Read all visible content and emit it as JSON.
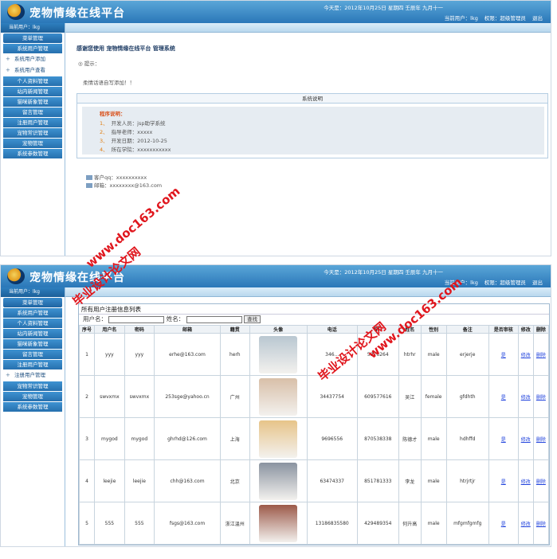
{
  "header": {
    "title": "宠物情缘在线平台",
    "date_text": "今天是：2012年10月25日 星期四 壬辰年 九月十一",
    "current_user": "当前用户：lkg",
    "role": "权限：超级管理员",
    "logout": "退出"
  },
  "sidebar": {
    "current_user_label": "当前用户：lkg",
    "menu_head": "菜单管理",
    "items_a": [
      {
        "label": "系统用户管理",
        "kind": "item"
      },
      {
        "label": "系统用户添加",
        "kind": "group"
      },
      {
        "label": "系统用户查看",
        "kind": "group"
      },
      {
        "label": "个人资料管理",
        "kind": "item"
      },
      {
        "label": "站内新闻管理",
        "kind": "item"
      },
      {
        "label": "猫咪新象管理",
        "kind": "item"
      },
      {
        "label": "留言管理",
        "kind": "item"
      },
      {
        "label": "注册用户管理",
        "kind": "item"
      },
      {
        "label": "宠物常识管理",
        "kind": "item"
      },
      {
        "label": "宠物管理",
        "kind": "item"
      },
      {
        "label": "系统参数管理",
        "kind": "item"
      }
    ],
    "items_b": [
      {
        "label": "系统用户管理",
        "kind": "item"
      },
      {
        "label": "个人资料管理",
        "kind": "item"
      },
      {
        "label": "站内新闻管理",
        "kind": "item"
      },
      {
        "label": "猫咪新象管理",
        "kind": "item"
      },
      {
        "label": "留言管理",
        "kind": "item"
      },
      {
        "label": "注册用户管理",
        "kind": "item"
      },
      {
        "label": "注册用户管理",
        "kind": "group"
      },
      {
        "label": "宠物常识管理",
        "kind": "item"
      },
      {
        "label": "宠物管理",
        "kind": "item"
      },
      {
        "label": "系统参数管理",
        "kind": "item"
      }
    ]
  },
  "welcome": {
    "heading": "感谢您使用 宠物情缘在线平台 管理系统",
    "tip": "提示：",
    "note": "柔情话语自写添加！！",
    "sys_title": "系统说明",
    "program_label": "程序说明：",
    "rows": [
      {
        "num": "1、",
        "text": "开发人员：jsp助学系统"
      },
      {
        "num": "2、",
        "text": "指导老师：xxxxx"
      },
      {
        "num": "3、",
        "text": "开发日期：2012-10-25"
      },
      {
        "num": "4、",
        "text": "所在学院：xxxxxxxxxxx"
      }
    ],
    "contact_qq": "客户qq：xxxxxxxxxx",
    "contact_mail": "邮箱：xxxxxxxx@163.com"
  },
  "watermark": {
    "site": "www.doc163.com",
    "cn": "毕业设计论文网"
  },
  "user_list": {
    "title": "所有用户注册信息列表",
    "search_username_label": "用户名：",
    "search_name_label": "姓名：",
    "search_button": "查找",
    "columns": [
      "序号",
      "用户名",
      "密码",
      "邮箱",
      "籍贯",
      "头像",
      "电话",
      "QQ",
      "姓名",
      "性别",
      "备注",
      "是否审核",
      "修改",
      "删除"
    ],
    "rows": [
      {
        "no": "1",
        "username": "yyy",
        "password": "yyy",
        "email": "erhe@163.com",
        "hometown": "herh",
        "phone": "346...",
        "qq": "5326264",
        "name": "htrhr",
        "gender": "male",
        "remark": "erjerje",
        "audit": "是",
        "edit": "修改",
        "del": "删除",
        "photo": "#b9c7d1"
      },
      {
        "no": "2",
        "username": "swvxmx",
        "password": "swvxmx",
        "email": "253sge@yahoo.cn",
        "hometown": "广州",
        "phone": "34437754",
        "qq": "609577616",
        "name": "吴江",
        "gender": "female",
        "remark": "gfdhth",
        "audit": "是",
        "edit": "修改",
        "del": "删除",
        "photo": "#d8bfa8"
      },
      {
        "no": "3",
        "username": "mygod",
        "password": "mygod",
        "email": "ghrhd@126.com",
        "hometown": "上海",
        "phone": "9696556",
        "qq": "870538338",
        "name": "陈德才",
        "gender": "male",
        "remark": "hdhffd",
        "audit": "是",
        "edit": "修改",
        "del": "删除",
        "photo": "#e7c489"
      },
      {
        "no": "4",
        "username": "leejie",
        "password": "leejie",
        "email": "chh@163.com",
        "hometown": "北京",
        "phone": "63474337",
        "qq": "851781333",
        "name": "李龙",
        "gender": "male",
        "remark": "htrjrtjr",
        "audit": "是",
        "edit": "修改",
        "del": "删除",
        "photo": "#8a93a0"
      },
      {
        "no": "5",
        "username": "555",
        "password": "555",
        "email": "fsgs@163.com",
        "hometown": "浙江温州",
        "phone": "13186835580",
        "qq": "429489354",
        "name": "何升高",
        "gender": "male",
        "remark": "mfgmfgmfg",
        "audit": "是",
        "edit": "修改",
        "del": "删除",
        "photo": "#9c5a4a"
      }
    ]
  }
}
